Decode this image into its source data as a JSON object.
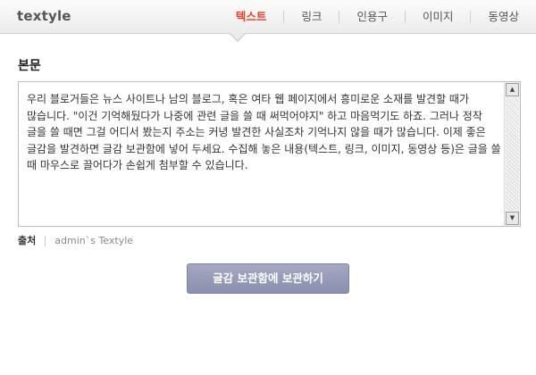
{
  "header": {
    "logo": "textyle",
    "tabs": [
      {
        "label": "텍스트",
        "active": true
      },
      {
        "label": "링크",
        "active": false
      },
      {
        "label": "인용구",
        "active": false
      },
      {
        "label": "이미지",
        "active": false
      },
      {
        "label": "동영상",
        "active": false
      }
    ],
    "accent_color": "#e1402a"
  },
  "main": {
    "section_title": "본문",
    "body_text": "우리 블로거들은 뉴스 사이트나 남의 블로그, 혹은 여타 웹 페이지에서 흥미로운 소재를 발견할 때가 많습니다. \"이건 기억해뒀다가 나중에 관련 글을 쓸 때 써먹어야지\" 하고 마음먹기도 하죠. 그러나 정작 글을 쓸 때면 그걸 어디서 봤는지 주소는 커녕 발견한 사실조차 기억나지 않을 때가 많습니다. 이제 좋은 글감을 발견하면 글감 보관함에 넣어 두세요. 수집해 놓은 내용(텍스트, 링크, 이미지, 동영상 등)은 글을 쓸 때 마우스로 끌어다가 손쉽게 첨부할 수 있습니다.",
    "source_label": "출처",
    "source_value": "admin`s Textyle",
    "save_button": "글감 보관함에 보관하기"
  },
  "icons": {
    "scroll_up": "arrow-up-icon",
    "scroll_down": "arrow-down-icon"
  }
}
